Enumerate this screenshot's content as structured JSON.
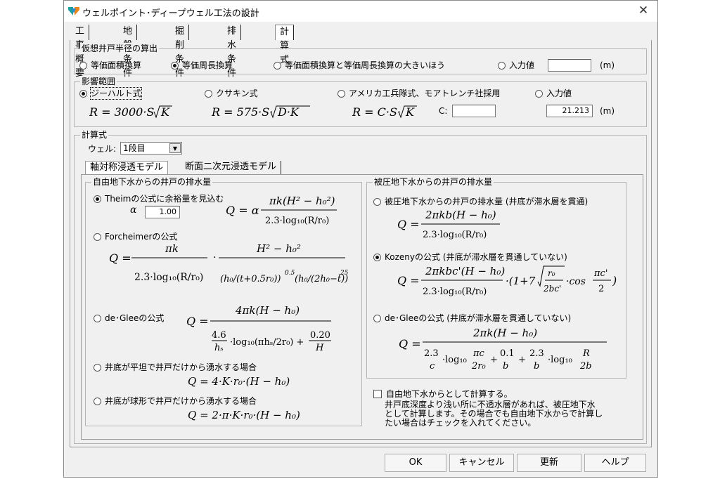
{
  "window": {
    "title": "ウェルポイント･ディープウェル工法の設計",
    "close": "✕"
  },
  "tabs": [
    "工事概要",
    "地盤条件",
    "掘削条件",
    "排水条件",
    "計算式"
  ],
  "radius": {
    "title": "仮想井戸半径の算出",
    "options": [
      "等価面積換算",
      "等価周長換算",
      "等価面積換算と等価周長換算の大きいほう",
      "入力値"
    ],
    "selected": 1,
    "input_value": "",
    "unit": "(m)"
  },
  "influence": {
    "title": "影響範囲",
    "options": [
      "ジーハルト式",
      "クサキン式",
      "アメリカ工兵隊式、モアトレンチ社採用",
      "入力値"
    ],
    "selected": 0,
    "c_label": "C:",
    "c_value": "",
    "input_value": "21.213",
    "unit": "(m)"
  },
  "calc": {
    "title": "計算式",
    "well_label": "ウェル:",
    "well_value": "1段目",
    "subtabs": [
      "軸対称浸透モデル",
      "断面二次元浸透モデル"
    ],
    "free": {
      "title": "自由地下水からの井戸の排水量",
      "options": [
        "Theimの公式に余裕量を見込む",
        "Forcheimerの公式",
        "de･Gleeの公式",
        "井底が平坦で井戸だけから湧水する場合",
        "井底が球形で井戸だけから湧水する場合"
      ],
      "selected": 0,
      "alpha_label": "α",
      "alpha_value": "1.00"
    },
    "confined": {
      "title": "被圧地下水からの井戸の排水量",
      "options": [
        "被圧地下水からの井戸の排水量 (井底が滞水層を貫通)",
        "Kozenyの公式 (井底が滞水層を貫通していない)",
        "de･Gleeの公式 (井底が滞水層を貫通していない)"
      ],
      "selected": 1
    },
    "free_check_label": "自由地下水からとして計算する。",
    "note": "井戸底深度より浅い所に不透水層があれば、被圧地下水\nとして計算します。その場合でも自由地下水からで計算し\nたい場合はチェックを入れてください。"
  },
  "buttons": {
    "ok": "OK",
    "cancel": "キャンセル",
    "update": "更新",
    "help": "ヘルプ"
  },
  "colors": {
    "window_bg": "#f0f0f0",
    "border": "#b5b5b5",
    "icon_teal": "#1e9e9e",
    "icon_orange": "#e8851b"
  }
}
